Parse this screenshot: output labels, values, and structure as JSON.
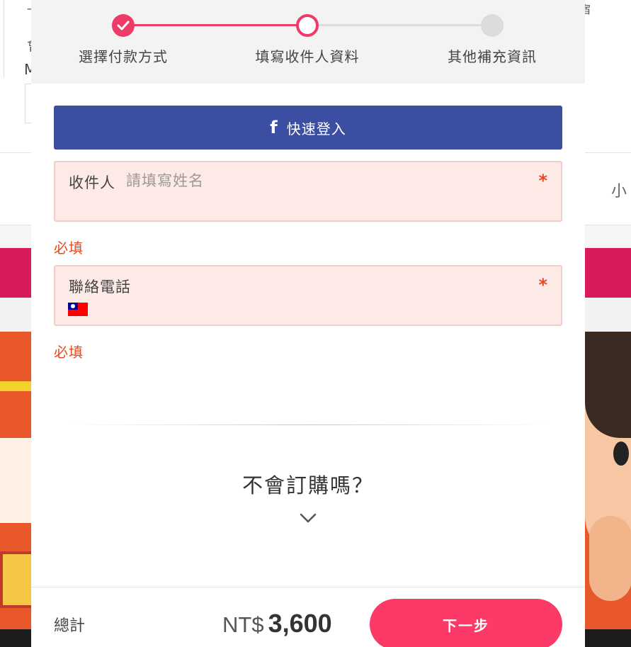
{
  "background": {
    "side_text": "小",
    "left_text_1": "會",
    "left_text_2": "M",
    "top_right_fragment": "宿",
    "top_left_fragment": "一"
  },
  "steps": [
    {
      "label": "選擇付款方式",
      "state": "done"
    },
    {
      "label": "填寫收件人資料",
      "state": "current"
    },
    {
      "label": "其他補充資訊",
      "state": "todo"
    }
  ],
  "facebook_login": {
    "icon": "facebook-f-icon",
    "label": "快速登入",
    "color": "#3b4ea1"
  },
  "recipient_field": {
    "label": "收件人",
    "placeholder": "請填寫姓名",
    "value": "",
    "required_mark": "*",
    "error": "必填"
  },
  "phone_field": {
    "label": "聯絡電話",
    "country_flag": "taiwan-flag-icon",
    "value": "",
    "required_mark": "*",
    "error": "必填"
  },
  "help": {
    "title": "不會訂購嗎？",
    "icon": "chevron-down-icon"
  },
  "footer": {
    "total_label": "總計",
    "currency": "NT$",
    "amount": "3,600",
    "next_label": "下一步"
  },
  "colors": {
    "accent": "#ef3b68",
    "next_button": "#fb3a68",
    "error": "#e8491d",
    "field_bg": "#fde9e6"
  }
}
